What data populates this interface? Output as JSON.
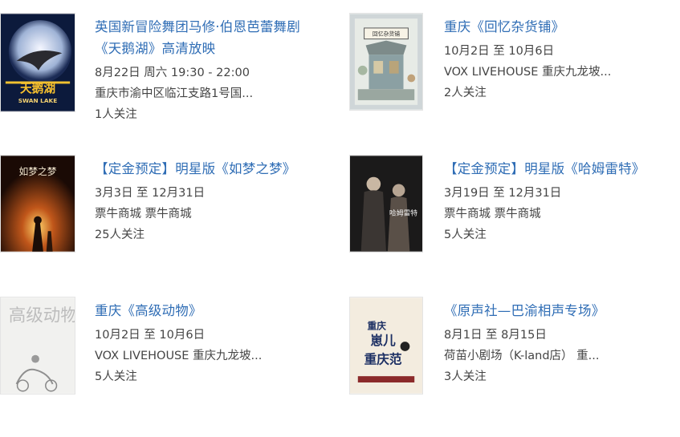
{
  "colors": {
    "title": "#2f6db5",
    "text": "#444444"
  },
  "events": [
    {
      "title_lines": [
        "英国新冒险舞团马修·伯恩芭蕾舞剧",
        "《天鹅湖》高清放映"
      ],
      "line1": "8月22日 周六  19:30 - 22:00",
      "line2": "重庆市渝中区临江支路1号国...",
      "follow": "1人关注",
      "poster": {
        "title": "天鹅湖",
        "subtitle": "SWAN LAKE"
      }
    },
    {
      "title_lines": [
        "重庆《回忆杂货铺》"
      ],
      "line1": "10月2日 至 10月6日",
      "line2": "VOX LIVEHOUSE 重庆九龙坡...",
      "follow": "2人关注",
      "poster": {
        "title": "回忆杂货铺"
      }
    },
    {
      "title_lines": [
        "【定金预定】明星版《如梦之梦》"
      ],
      "line1": "3月3日 至 12月31日",
      "line2": "票牛商城 票牛商城",
      "follow": "25人关注",
      "poster": {
        "title": "如梦之梦"
      }
    },
    {
      "title_lines": [
        "【定金预定】明星版《哈姆雷特》"
      ],
      "line1": "3月19日 至 12月31日",
      "line2": "票牛商城 票牛商城",
      "follow": "5人关注",
      "poster": {
        "title": "哈姆雷特"
      }
    },
    {
      "title_lines": [
        "重庆《高级动物》"
      ],
      "line1": "10月2日 至 10月6日",
      "line2": "VOX LIVEHOUSE 重庆九龙坡...",
      "follow": "5人关注",
      "poster": {
        "title": "高级动物"
      }
    },
    {
      "title_lines": [
        "《原声社—巴渝相声专场》"
      ],
      "line1": "8月1日 至 8月15日",
      "line2": "荷苗小剧场（K-land店） 重...",
      "follow": "3人关注",
      "poster": {
        "title_a": "重庆",
        "title_b": "崽儿",
        "title_c": "重庆范"
      }
    }
  ]
}
